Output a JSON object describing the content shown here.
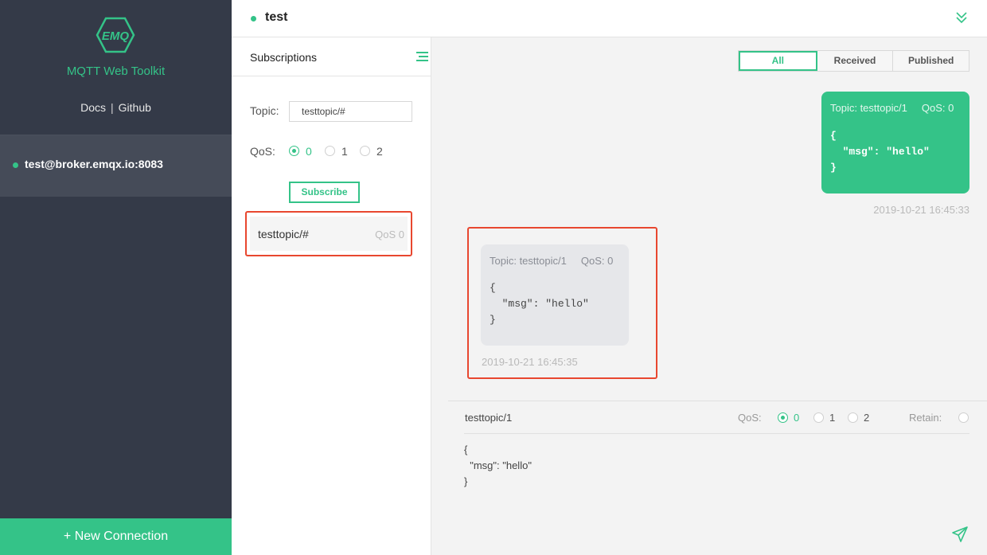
{
  "sidebar": {
    "logo_text": "EMQ",
    "toolkit_title": "MQTT Web Toolkit",
    "docs_link": "Docs",
    "link_separator": "|",
    "github_link": "Github",
    "connections": [
      {
        "label": "test@broker.emqx.io:8083",
        "status_color": "#34c388"
      }
    ],
    "new_connection_label": "+ New Connection"
  },
  "header": {
    "title": "test",
    "collapse_icon": "double-chevron-down-icon"
  },
  "subscriptions": {
    "title": "Subscriptions",
    "menu_icon": "list-menu-icon",
    "topic_label": "Topic:",
    "topic_value": "testtopic/#",
    "qos_label": "QoS:",
    "qos_options": [
      "0",
      "1",
      "2"
    ],
    "qos_selected": "0",
    "subscribe_label": "Subscribe",
    "items": [
      {
        "topic": "testtopic/#",
        "qos": "QoS 0"
      }
    ]
  },
  "messages": {
    "filters": [
      "All",
      "Received",
      "Published"
    ],
    "active_filter": "All",
    "published": {
      "topic": "Topic: testtopic/1",
      "qos": "QoS: 0",
      "payload": "{\n  \"msg\": \"hello\"\n}",
      "time": "2019-10-21 16:45:33"
    },
    "received": {
      "topic": "Topic: testtopic/1",
      "qos": "QoS: 0",
      "payload": "{\n  \"msg\": \"hello\"\n}",
      "time": "2019-10-21 16:45:35"
    }
  },
  "composer": {
    "topic": "testtopic/1",
    "qos_label": "QoS:",
    "qos_options": [
      "0",
      "1",
      "2"
    ],
    "qos_selected": "0",
    "retain_label": "Retain:",
    "payload": "{\n  \"msg\": \"hello\"\n}",
    "send_icon": "send-icon"
  },
  "colors": {
    "accent": "#34c388",
    "sidebar_bg": "#343a48",
    "highlight": "#e8472f"
  }
}
